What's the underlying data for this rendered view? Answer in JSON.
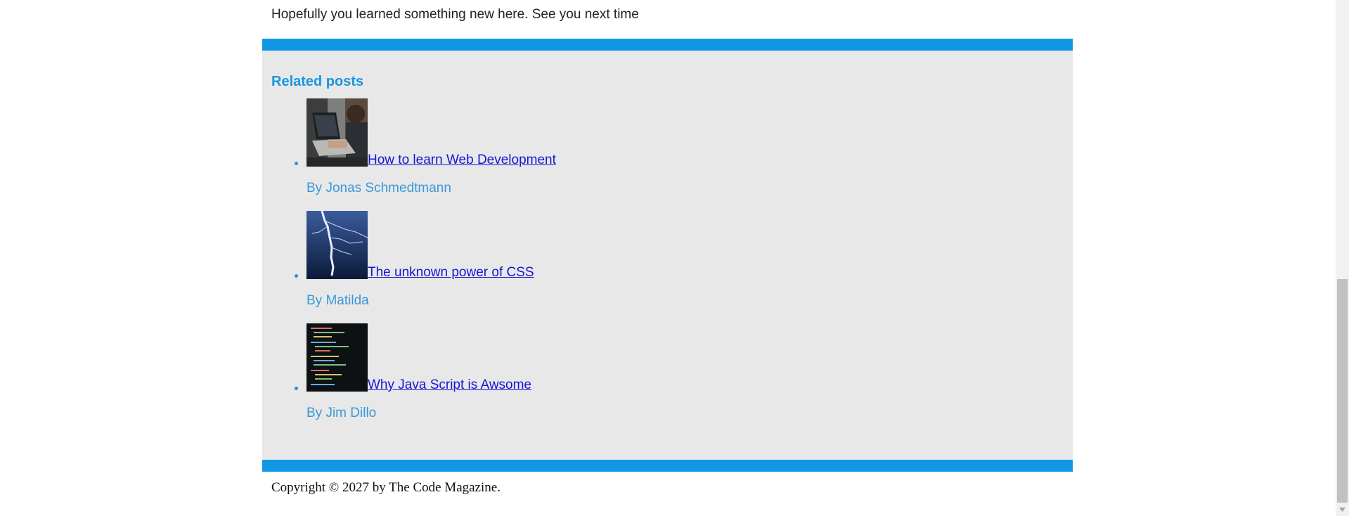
{
  "article": {
    "closing_text": "Hopefully you learned something new here. See you next time"
  },
  "related": {
    "title": "Related posts",
    "posts": [
      {
        "title": "How to learn Web Development",
        "author": "By Jonas Schmedtmann",
        "thumbnail": "person-with-laptop-image"
      },
      {
        "title": "The unknown power of CSS",
        "author": "By Matilda",
        "thumbnail": "lightning-image"
      },
      {
        "title": "Why Java Script is Awsome",
        "author": "By Jim Dillo",
        "thumbnail": "code-screen-image"
      }
    ]
  },
  "footer": {
    "copyright": "Copyright © 2027 by The Code Magazine."
  },
  "colors": {
    "accent": "#1098e6",
    "related_bg": "#e8e8e9",
    "link": "#1616d4",
    "author": "#3a98d8"
  }
}
